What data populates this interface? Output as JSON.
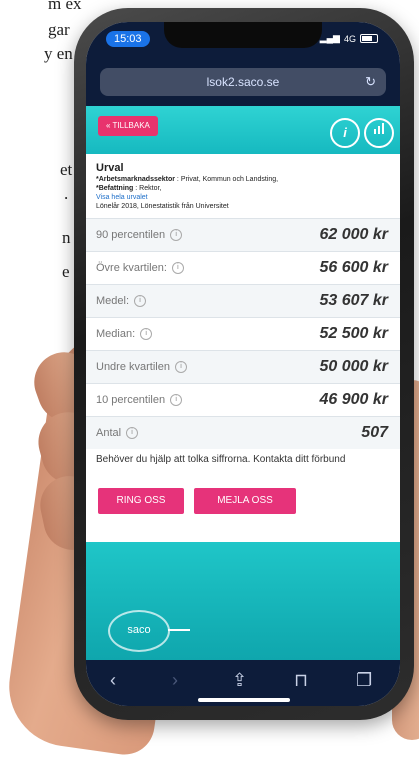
{
  "background_text": [
    "m ex",
    "gar",
    "y en",
    "et",
    ".",
    "n",
    "e",
    "",
    ""
  ],
  "status_bar": {
    "time": "15:03",
    "network": "4G"
  },
  "browser": {
    "url": "lsok2.saco.se"
  },
  "header": {
    "back_label": "« TILLBAKA",
    "info_icon": "i",
    "chart_icon": "chart-icon"
  },
  "urval": {
    "title": "Urval",
    "line1_label": "*Arbetsmarknadssektor",
    "line1_value": " : Privat, Kommun och Landsting,",
    "line2_label": "*Befattning",
    "line2_value": " : Rektor,",
    "link": "Visa hela urvalet",
    "source": "Lönelår 2018, Lönestatistik från Universitet"
  },
  "rows": [
    {
      "label": "90 percentilen",
      "value": "62 000 kr"
    },
    {
      "label": "Övre kvartilen:",
      "value": "56 600 kr"
    },
    {
      "label": "Medel:",
      "value": "53 607 kr"
    },
    {
      "label": "Median:",
      "value": "52 500 kr"
    },
    {
      "label": "Undre kvartilen",
      "value": "50 000 kr"
    },
    {
      "label": "10 percentilen",
      "value": "46 900 kr"
    },
    {
      "label": "Antal",
      "value": "507"
    }
  ],
  "help_text": "Behöver du hjälp att tolka siffrorna. Kontakta ditt förbund",
  "buttons": {
    "ring": "RING OSS",
    "mail": "MEJLA OSS"
  },
  "footer": {
    "logo_text": "saco"
  },
  "colors": {
    "teal": "#1cc0c4",
    "pink": "#e6337a",
    "navy": "#0d1c3a"
  }
}
